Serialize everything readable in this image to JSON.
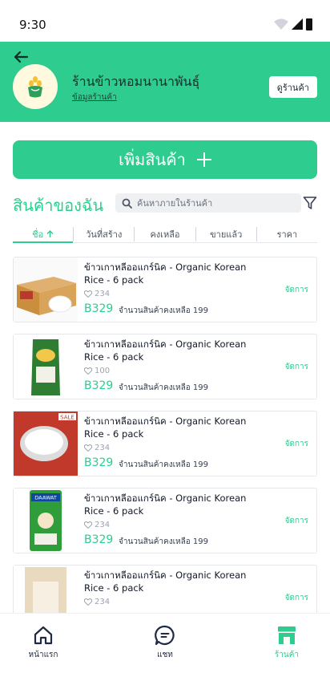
{
  "status_bar": {
    "time": "9:30"
  },
  "header": {
    "shop_name": "ร้านข้าวหอมนานาพันธุ์",
    "shop_info_link": "ข้อมูลร้านค้า",
    "view_shop_button": "ดูร้านค้า",
    "background_color": "#2ecc8f"
  },
  "add_product": {
    "label": "เพิ่มสินค้า"
  },
  "products_section": {
    "title": "สินค้าของฉัน",
    "search_placeholder": "ค้นหาภายในร้านค้า"
  },
  "sort_tabs": [
    {
      "label": "ชื่อ",
      "active": true
    },
    {
      "label": "วันที่สร้าง"
    },
    {
      "label": "คงเหลือ"
    },
    {
      "label": "ขายแล้ว"
    },
    {
      "label": "ราคา"
    }
  ],
  "products": [
    {
      "title": "ข้าวเกาหลีออแกร์นิค - Organic Korean Rice - 6 pack",
      "likes": "234",
      "price": "B329",
      "stock": "จำนวนสินค้าคงเหลือ 199",
      "action": "จัดการ"
    },
    {
      "title": "ข้าวเกาหลีออแกร์นิค - Organic Korean Rice - 6 pack",
      "likes": "100",
      "price": "B329",
      "stock": "จำนวนสินค้าคงเหลือ 199",
      "action": "จัดการ"
    },
    {
      "title": "ข้าวเกาหลีออแกร์นิค - Organic Korean Rice - 6 pack",
      "likes": "234",
      "price": "B329",
      "stock": "จำนวนสินค้าคงเหลือ 199",
      "action": "จัดการ",
      "image_badge": "SALE"
    },
    {
      "title": "ข้าวเกาหลีออแกร์นิค - Organic Korean Rice - 6 pack",
      "likes": "234",
      "price": "B329",
      "stock": "จำนวนสินค้าคงเหลือ 199",
      "action": "จัดการ",
      "image_text": "DAAWAT"
    },
    {
      "title": "ข้าวเกาหลีออแกร์นิค - Organic Korean Rice - 6 pack",
      "likes": "234",
      "price": "",
      "stock": "",
      "action": "จัดการ"
    }
  ],
  "bottom_nav": {
    "home": "หน้าแรก",
    "chat": "แชท",
    "shop": "ร้านค้า"
  },
  "colors": {
    "accent": "#2ecc8f",
    "nav_dark": "#1f2a44"
  }
}
